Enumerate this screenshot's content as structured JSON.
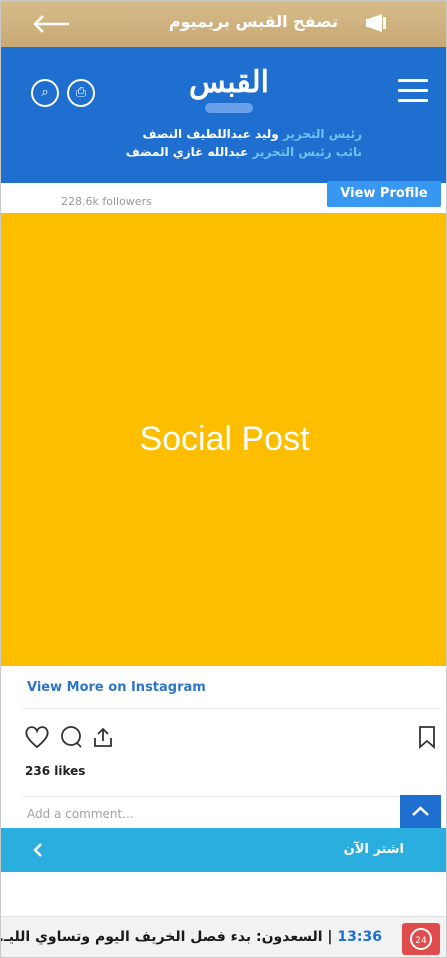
{
  "promo": {
    "title": "تصفح القبس بريميوم"
  },
  "header": {
    "logo": "القبس",
    "editor_role": "رئيس التحرير",
    "editor_name": "وليد عبداللطيف النصف",
    "deputy_role": "نائب رئيس التحرير",
    "deputy_name": "عبدالله غازي المضف"
  },
  "embed": {
    "followers": "228.6k followers",
    "view_profile": "View Profile",
    "post_label": "Social Post",
    "view_more": "View More on Instagram",
    "likes": "236 likes",
    "comment_placeholder": "Add a comment..."
  },
  "news_bar": {
    "label": "اشتر الآن"
  },
  "ticker": {
    "time": "13:36",
    "separator": " | ",
    "headline": "السعدون: بدء فصل الخريف اليوم وتساوي الليـ..."
  },
  "colors": {
    "promo": "#c8a874",
    "header": "#1f6fd1",
    "post": "#fdbe00",
    "news_bar": "#2aaee0",
    "badge": "#e04b4b"
  }
}
